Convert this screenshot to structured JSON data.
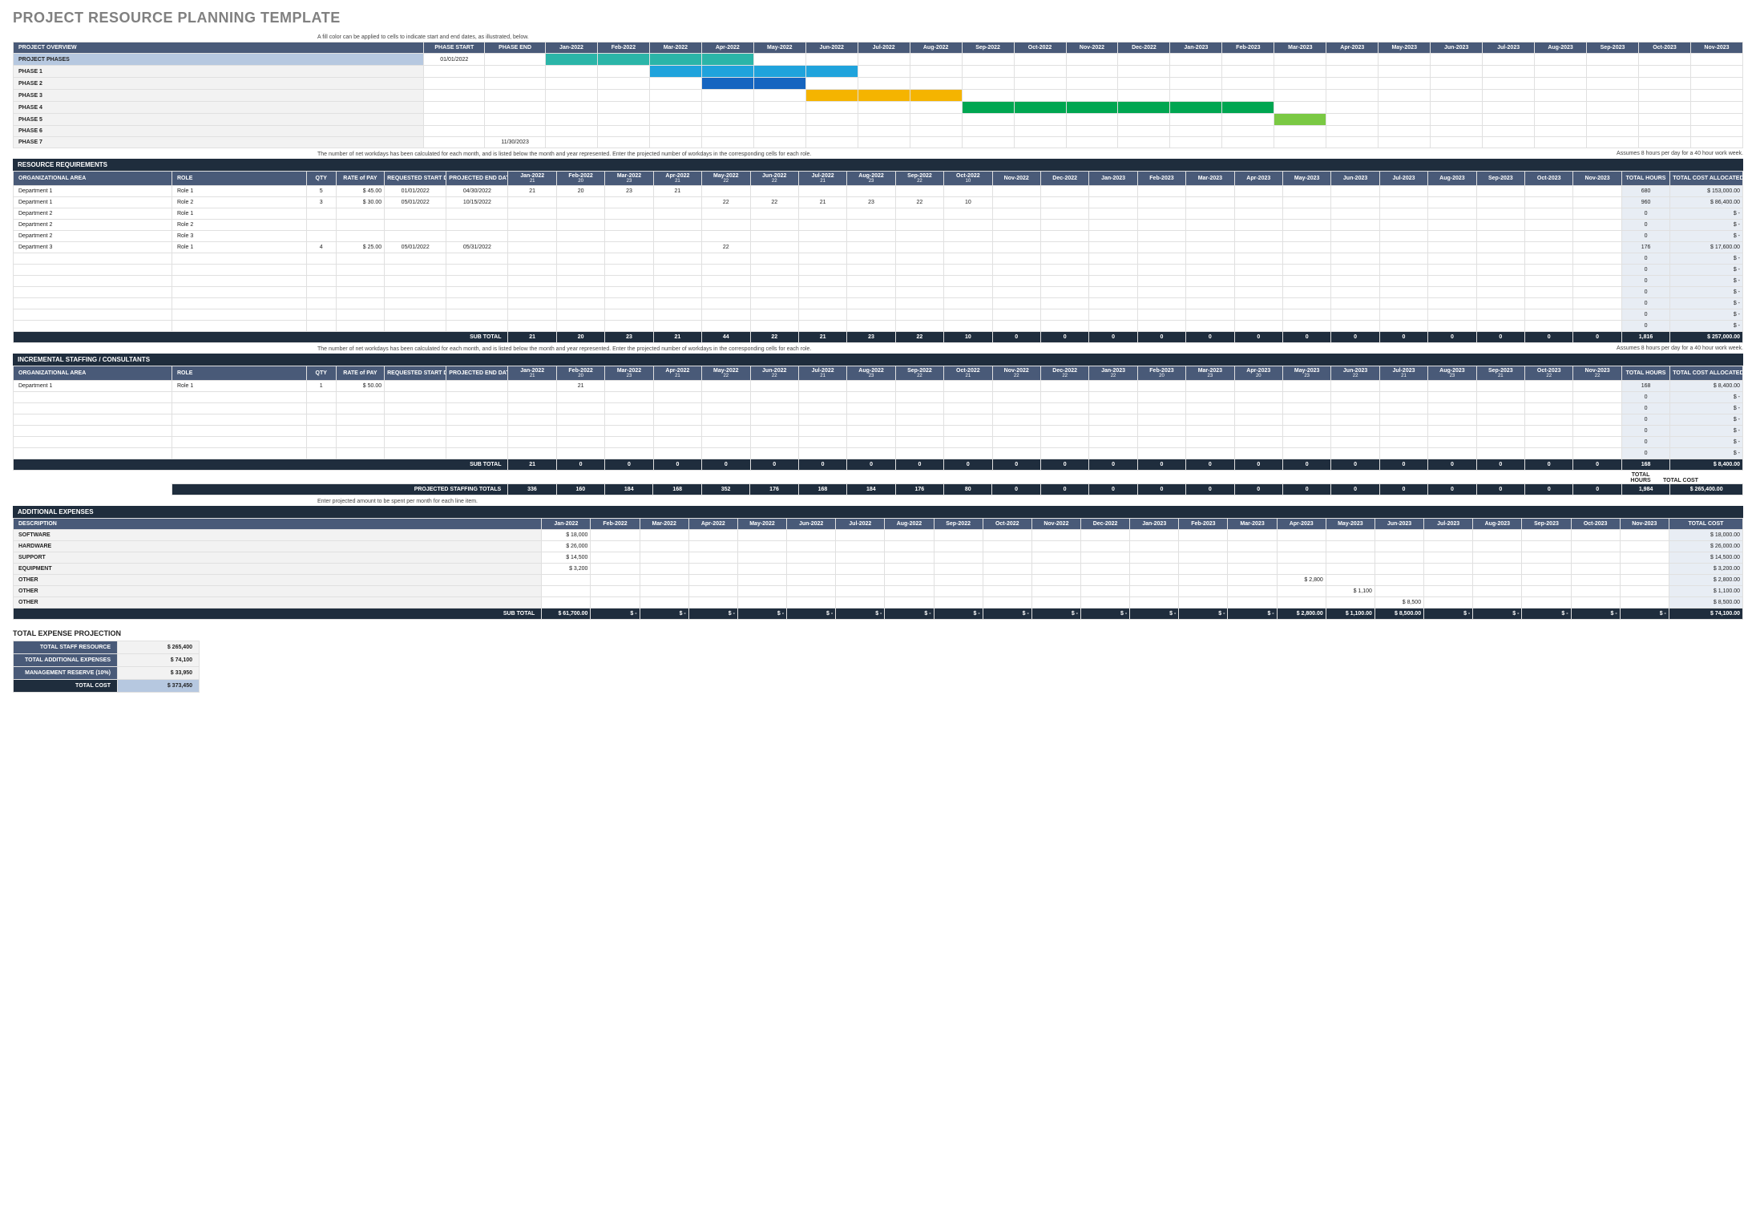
{
  "title": "PROJECT RESOURCE PLANNING TEMPLATE",
  "notes": {
    "gantt_hint": "A fill color can be applied to cells to indicate start and end dates, as illustrated, below.",
    "workday_hint": "The number of net workdays has been calculated for each month, and is listed below the month and year represented. Enter the projected number of workdays in the corresponding cells for each role.",
    "assumption": "Assumes 8 hours per day for a 40 hour work week.",
    "expense_hint": "Enter projected amount to be spent per month for each line item.",
    "totals_hours_lbl": "TOTAL HOURS",
    "totals_cost_lbl": "TOTAL COST"
  },
  "months": [
    "Jan-2022",
    "Feb-2022",
    "Mar-2022",
    "Apr-2022",
    "May-2022",
    "Jun-2022",
    "Jul-2022",
    "Aug-2022",
    "Sep-2022",
    "Oct-2022",
    "Nov-2022",
    "Dec-2022",
    "Jan-2023",
    "Feb-2023",
    "Mar-2023",
    "Apr-2023",
    "May-2023",
    "Jun-2023",
    "Jul-2023",
    "Aug-2023",
    "Sep-2023",
    "Oct-2023",
    "Nov-2023"
  ],
  "workdays": [
    "21",
    "20",
    "23",
    "21",
    "22",
    "22",
    "21",
    "23",
    "22",
    "21",
    "22",
    "22",
    "22",
    "20",
    "23",
    "20",
    "23",
    "22",
    "21",
    "23",
    "21",
    "22",
    "22"
  ],
  "workdays2": [
    "21",
    "20",
    "23",
    "21",
    "22",
    "22",
    "21",
    "23",
    "22",
    "10",
    "",
    "",
    "",
    "",
    "",
    "",
    "",
    "",
    "",
    "",
    "",
    "",
    ""
  ],
  "overview": {
    "section": "PROJECT OVERVIEW",
    "h_start": "PHASE START",
    "h_end": "PHASE END",
    "rows": [
      {
        "name": "PROJECT PHASES",
        "start": "01/01/2022",
        "end": "",
        "type": "hdr",
        "bars": [
          0,
          1,
          2,
          3
        ]
      },
      {
        "name": "PHASE 1",
        "start": "",
        "end": "",
        "type": "t2",
        "bars": [
          2,
          3,
          4,
          5
        ]
      },
      {
        "name": "PHASE 2",
        "start": "",
        "end": "",
        "type": "t3",
        "bars": [
          3,
          4
        ]
      },
      {
        "name": "PHASE 3",
        "start": "",
        "end": "",
        "type": "t4",
        "bars": [
          5,
          6,
          7
        ]
      },
      {
        "name": "PHASE 4",
        "start": "",
        "end": "",
        "type": "t5",
        "bars": [
          8,
          9,
          10,
          11,
          12,
          13
        ]
      },
      {
        "name": "PHASE 5",
        "start": "",
        "end": "",
        "type": "t6",
        "bars": [
          14
        ]
      },
      {
        "name": "PHASE 6",
        "start": "",
        "end": "",
        "type": "",
        "bars": []
      },
      {
        "name": "PHASE 7",
        "start": "",
        "end": "11/30/2023",
        "type": "",
        "bars": []
      }
    ]
  },
  "resources": {
    "section": "RESOURCE REQUIREMENTS",
    "headers": {
      "area": "ORGANIZATIONAL AREA",
      "role": "ROLE",
      "qty": "QTY",
      "rate": "RATE of PAY",
      "req": "REQUESTED START DATE",
      "end": "PROJECTED END DATE",
      "hrs": "TOTAL HOURS",
      "cost": "TOTAL COST ALLOCATED"
    },
    "rows": [
      {
        "area": "Department 1",
        "role": "Role 1",
        "qty": "5",
        "rate": "$   45.00",
        "req": "01/01/2022",
        "end": "04/30/2022",
        "m": [
          "21",
          "20",
          "23",
          "21",
          "",
          "",
          "",
          "",
          "",
          "",
          "",
          "",
          "",
          "",
          "",
          "",
          "",
          "",
          "",
          "",
          "",
          "",
          ""
        ],
        "hrs": "680",
        "cost": "$   153,000.00"
      },
      {
        "area": "Department 1",
        "role": "Role 2",
        "qty": "3",
        "rate": "$   30.00",
        "req": "05/01/2022",
        "end": "10/15/2022",
        "m": [
          "",
          "",
          "",
          "",
          "22",
          "22",
          "21",
          "23",
          "22",
          "10",
          "",
          "",
          "",
          "",
          "",
          "",
          "",
          "",
          "",
          "",
          "",
          "",
          ""
        ],
        "hrs": "960",
        "cost": "$    86,400.00"
      },
      {
        "area": "Department 2",
        "role": "Role 1",
        "qty": "",
        "rate": "",
        "req": "",
        "end": "",
        "m": [
          "",
          "",
          "",
          "",
          "",
          "",
          "",
          "",
          "",
          "",
          "",
          "",
          "",
          "",
          "",
          "",
          "",
          "",
          "",
          "",
          "",
          "",
          ""
        ],
        "hrs": "0",
        "cost": "$         -"
      },
      {
        "area": "Department 2",
        "role": "Role 2",
        "qty": "",
        "rate": "",
        "req": "",
        "end": "",
        "m": [
          "",
          "",
          "",
          "",
          "",
          "",
          "",
          "",
          "",
          "",
          "",
          "",
          "",
          "",
          "",
          "",
          "",
          "",
          "",
          "",
          "",
          "",
          ""
        ],
        "hrs": "0",
        "cost": "$         -"
      },
      {
        "area": "Department 2",
        "role": "Role 3",
        "qty": "",
        "rate": "",
        "req": "",
        "end": "",
        "m": [
          "",
          "",
          "",
          "",
          "",
          "",
          "",
          "",
          "",
          "",
          "",
          "",
          "",
          "",
          "",
          "",
          "",
          "",
          "",
          "",
          "",
          "",
          ""
        ],
        "hrs": "0",
        "cost": "$         -"
      },
      {
        "area": "Department 3",
        "role": "Role 1",
        "qty": "4",
        "rate": "$   25.00",
        "req": "05/01/2022",
        "end": "05/31/2022",
        "m": [
          "",
          "",
          "",
          "",
          "22",
          "",
          "",
          "",
          "",
          "",
          "",
          "",
          "",
          "",
          "",
          "",
          "",
          "",
          "",
          "",
          "",
          "",
          ""
        ],
        "hrs": "176",
        "cost": "$    17,600.00"
      },
      {
        "area": "",
        "role": "",
        "qty": "",
        "rate": "",
        "req": "",
        "end": "",
        "m": [
          "",
          "",
          "",
          "",
          "",
          "",
          "",
          "",
          "",
          "",
          "",
          "",
          "",
          "",
          "",
          "",
          "",
          "",
          "",
          "",
          "",
          "",
          ""
        ],
        "hrs": "0",
        "cost": "$         -"
      },
      {
        "area": "",
        "role": "",
        "qty": "",
        "rate": "",
        "req": "",
        "end": "",
        "m": [
          "",
          "",
          "",
          "",
          "",
          "",
          "",
          "",
          "",
          "",
          "",
          "",
          "",
          "",
          "",
          "",
          "",
          "",
          "",
          "",
          "",
          "",
          ""
        ],
        "hrs": "0",
        "cost": "$         -"
      },
      {
        "area": "",
        "role": "",
        "qty": "",
        "rate": "",
        "req": "",
        "end": "",
        "m": [
          "",
          "",
          "",
          "",
          "",
          "",
          "",
          "",
          "",
          "",
          "",
          "",
          "",
          "",
          "",
          "",
          "",
          "",
          "",
          "",
          "",
          "",
          ""
        ],
        "hrs": "0",
        "cost": "$         -"
      },
      {
        "area": "",
        "role": "",
        "qty": "",
        "rate": "",
        "req": "",
        "end": "",
        "m": [
          "",
          "",
          "",
          "",
          "",
          "",
          "",
          "",
          "",
          "",
          "",
          "",
          "",
          "",
          "",
          "",
          "",
          "",
          "",
          "",
          "",
          "",
          ""
        ],
        "hrs": "0",
        "cost": "$         -"
      },
      {
        "area": "",
        "role": "",
        "qty": "",
        "rate": "",
        "req": "",
        "end": "",
        "m": [
          "",
          "",
          "",
          "",
          "",
          "",
          "",
          "",
          "",
          "",
          "",
          "",
          "",
          "",
          "",
          "",
          "",
          "",
          "",
          "",
          "",
          "",
          ""
        ],
        "hrs": "0",
        "cost": "$         -"
      },
      {
        "area": "",
        "role": "",
        "qty": "",
        "rate": "",
        "req": "",
        "end": "",
        "m": [
          "",
          "",
          "",
          "",
          "",
          "",
          "",
          "",
          "",
          "",
          "",
          "",
          "",
          "",
          "",
          "",
          "",
          "",
          "",
          "",
          "",
          "",
          ""
        ],
        "hrs": "0",
        "cost": "$         -"
      },
      {
        "area": "",
        "role": "",
        "qty": "",
        "rate": "",
        "req": "",
        "end": "",
        "m": [
          "",
          "",
          "",
          "",
          "",
          "",
          "",
          "",
          "",
          "",
          "",
          "",
          "",
          "",
          "",
          "",
          "",
          "",
          "",
          "",
          "",
          "",
          ""
        ],
        "hrs": "0",
        "cost": "$         -"
      }
    ],
    "subtotal": {
      "label": "SUB TOTAL",
      "m": [
        "21",
        "20",
        "23",
        "21",
        "44",
        "22",
        "21",
        "23",
        "22",
        "10",
        "0",
        "0",
        "0",
        "0",
        "0",
        "0",
        "0",
        "0",
        "0",
        "0",
        "0",
        "0",
        "0"
      ],
      "hrs": "1,816",
      "cost": "$   257,000.00"
    }
  },
  "incremental": {
    "section": "INCREMENTAL STAFFING / CONSULTANTS",
    "rows": [
      {
        "area": "Department 1",
        "role": "Role 1",
        "qty": "1",
        "rate": "$   50.00",
        "req": "",
        "end": "",
        "m": [
          "",
          "21",
          "",
          "",
          "",
          "",
          "",
          "",
          "",
          "",
          "",
          "",
          "",
          "",
          "",
          "",
          "",
          "",
          "",
          "",
          "",
          "",
          ""
        ],
        "hrs": "168",
        "cost": "$     8,400.00"
      },
      {
        "area": "",
        "role": "",
        "qty": "",
        "rate": "",
        "req": "",
        "end": "",
        "m": [
          "",
          "",
          "",
          "",
          "",
          "",
          "",
          "",
          "",
          "",
          "",
          "",
          "",
          "",
          "",
          "",
          "",
          "",
          "",
          "",
          "",
          "",
          ""
        ],
        "hrs": "0",
        "cost": "$         -"
      },
      {
        "area": "",
        "role": "",
        "qty": "",
        "rate": "",
        "req": "",
        "end": "",
        "m": [
          "",
          "",
          "",
          "",
          "",
          "",
          "",
          "",
          "",
          "",
          "",
          "",
          "",
          "",
          "",
          "",
          "",
          "",
          "",
          "",
          "",
          "",
          ""
        ],
        "hrs": "0",
        "cost": "$         -"
      },
      {
        "area": "",
        "role": "",
        "qty": "",
        "rate": "",
        "req": "",
        "end": "",
        "m": [
          "",
          "",
          "",
          "",
          "",
          "",
          "",
          "",
          "",
          "",
          "",
          "",
          "",
          "",
          "",
          "",
          "",
          "",
          "",
          "",
          "",
          "",
          ""
        ],
        "hrs": "0",
        "cost": "$         -"
      },
      {
        "area": "",
        "role": "",
        "qty": "",
        "rate": "",
        "req": "",
        "end": "",
        "m": [
          "",
          "",
          "",
          "",
          "",
          "",
          "",
          "",
          "",
          "",
          "",
          "",
          "",
          "",
          "",
          "",
          "",
          "",
          "",
          "",
          "",
          "",
          ""
        ],
        "hrs": "0",
        "cost": "$         -"
      },
      {
        "area": "",
        "role": "",
        "qty": "",
        "rate": "",
        "req": "",
        "end": "",
        "m": [
          "",
          "",
          "",
          "",
          "",
          "",
          "",
          "",
          "",
          "",
          "",
          "",
          "",
          "",
          "",
          "",
          "",
          "",
          "",
          "",
          "",
          "",
          ""
        ],
        "hrs": "0",
        "cost": "$         -"
      },
      {
        "area": "",
        "role": "",
        "qty": "",
        "rate": "",
        "req": "",
        "end": "",
        "m": [
          "",
          "",
          "",
          "",
          "",
          "",
          "",
          "",
          "",
          "",
          "",
          "",
          "",
          "",
          "",
          "",
          "",
          "",
          "",
          "",
          "",
          "",
          ""
        ],
        "hrs": "0",
        "cost": "$         -"
      }
    ],
    "subtotal": {
      "label": "SUB TOTAL",
      "m": [
        "21",
        "0",
        "0",
        "0",
        "0",
        "0",
        "0",
        "0",
        "0",
        "0",
        "0",
        "0",
        "0",
        "0",
        "0",
        "0",
        "0",
        "0",
        "0",
        "0",
        "0",
        "0",
        "0"
      ],
      "hrs": "168",
      "cost": "$     8,400.00"
    },
    "staffing_totals": {
      "label": "PROJECTED STAFFING TOTALS",
      "m": [
        "336",
        "160",
        "184",
        "168",
        "352",
        "176",
        "168",
        "184",
        "176",
        "80",
        "0",
        "0",
        "0",
        "0",
        "0",
        "0",
        "0",
        "0",
        "0",
        "0",
        "0",
        "0",
        "0"
      ],
      "hrs": "1,984",
      "cost": "$   265,400.00"
    }
  },
  "expenses": {
    "section": "ADDITIONAL EXPENSES",
    "h_desc": "DESCRIPTION",
    "h_total": "TOTAL COST",
    "rows": [
      {
        "desc": "SOFTWARE",
        "m": [
          "$  18,000",
          "",
          "",
          "",
          "",
          "",
          "",
          "",
          "",
          "",
          "",
          "",
          "",
          "",
          "",
          "",
          "",
          "",
          "",
          "",
          "",
          "",
          ""
        ],
        "total": "$    18,000.00"
      },
      {
        "desc": "HARDWARE",
        "m": [
          "$  26,000",
          "",
          "",
          "",
          "",
          "",
          "",
          "",
          "",
          "",
          "",
          "",
          "",
          "",
          "",
          "",
          "",
          "",
          "",
          "",
          "",
          "",
          ""
        ],
        "total": "$    26,000.00"
      },
      {
        "desc": "SUPPORT",
        "m": [
          "$  14,500",
          "",
          "",
          "",
          "",
          "",
          "",
          "",
          "",
          "",
          "",
          "",
          "",
          "",
          "",
          "",
          "",
          "",
          "",
          "",
          "",
          "",
          ""
        ],
        "total": "$    14,500.00"
      },
      {
        "desc": "EQUIPMENT",
        "m": [
          "$   3,200",
          "",
          "",
          "",
          "",
          "",
          "",
          "",
          "",
          "",
          "",
          "",
          "",
          "",
          "",
          "",
          "",
          "",
          "",
          "",
          "",
          "",
          ""
        ],
        "total": "$     3,200.00"
      },
      {
        "desc": "OTHER",
        "m": [
          "",
          "",
          "",
          "",
          "",
          "",
          "",
          "",
          "",
          "",
          "",
          "",
          "",
          "",
          "",
          "$  2,800",
          "",
          "",
          "",
          "",
          "",
          "",
          ""
        ],
        "total": "$     2,800.00"
      },
      {
        "desc": "OTHER",
        "m": [
          "",
          "",
          "",
          "",
          "",
          "",
          "",
          "",
          "",
          "",
          "",
          "",
          "",
          "",
          "",
          "",
          "$  1,100",
          "",
          "",
          "",
          "",
          "",
          ""
        ],
        "total": "$     1,100.00"
      },
      {
        "desc": "OTHER",
        "m": [
          "",
          "",
          "",
          "",
          "",
          "",
          "",
          "",
          "",
          "",
          "",
          "",
          "",
          "",
          "",
          "",
          "",
          "$  8,500",
          "",
          "",
          "",
          "",
          ""
        ],
        "total": "$     8,500.00"
      }
    ],
    "subtotal": {
      "label": "SUB TOTAL",
      "m": [
        "$ 61,700.00",
        "$     -",
        "$     -",
        "$     -",
        "$     -",
        "$     -",
        "$     -",
        "$     -",
        "$     -",
        "$     -",
        "$     -",
        "$     -",
        "$     -",
        "$     -",
        "$     -",
        "$ 2,800.00",
        "$ 1,100.00",
        "$ 8,500.00",
        "$     -",
        "$     -",
        "$     -",
        "$     -",
        "$     -"
      ],
      "total": "$    74,100.00"
    }
  },
  "summary": {
    "title": "TOTAL EXPENSE PROJECTION",
    "rows": [
      {
        "label": "TOTAL STAFF RESOURCE",
        "val": "$                     265,400"
      },
      {
        "label": "TOTAL ADDITIONAL EXPENSES",
        "val": "$                       74,100"
      },
      {
        "label": "MANAGEMENT RESERVE (10%)",
        "val": "$                       33,950"
      },
      {
        "label": "TOTAL COST",
        "val": "$                     373,450"
      }
    ]
  }
}
